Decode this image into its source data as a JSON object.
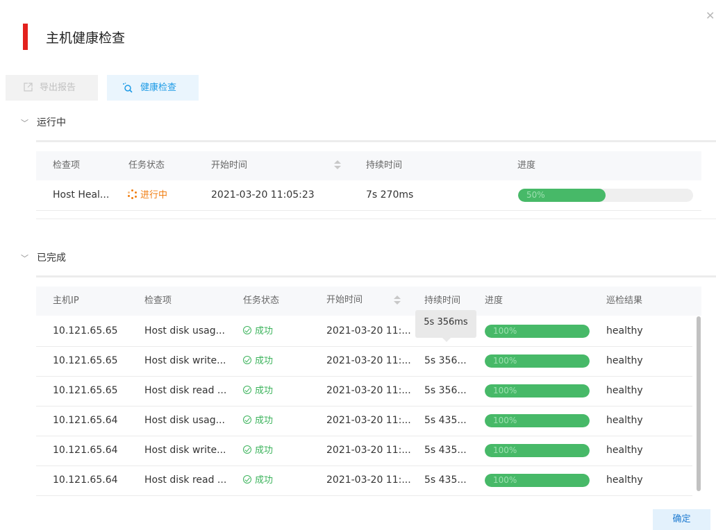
{
  "dialog": {
    "title": "主机健康检查",
    "accent_color": "#e3211d"
  },
  "toolbar": {
    "export_label": "导出报告",
    "check_label": "健康检查"
  },
  "running": {
    "section_label": "运行中",
    "columns": [
      "检查项",
      "任务状态",
      "开始时间",
      "持续时间",
      "进度"
    ],
    "rows": [
      {
        "item": "Host Heal...",
        "status": "进行中",
        "start": "2021-03-20 11:05:23",
        "duration": "7s 270ms",
        "progress": 0.5,
        "progress_label": "50%"
      }
    ]
  },
  "completed": {
    "section_label": "已完成",
    "columns": [
      "主机IP",
      "检查项",
      "任务状态",
      "开始时间",
      "持续时间",
      "进度",
      "巡检结果"
    ],
    "rows": [
      {
        "ip": "10.121.65.65",
        "item": "Host disk usag...",
        "status": "成功",
        "start": "2021-03-20 11:...",
        "duration": "5s 356...",
        "progress": 1.0,
        "progress_label": "100%",
        "result": "healthy"
      },
      {
        "ip": "10.121.65.65",
        "item": "Host disk write...",
        "status": "成功",
        "start": "2021-03-20 11:...",
        "duration": "5s 356...",
        "progress": 1.0,
        "progress_label": "100%",
        "result": "healthy"
      },
      {
        "ip": "10.121.65.65",
        "item": "Host disk read ...",
        "status": "成功",
        "start": "2021-03-20 11:...",
        "duration": "5s 356...",
        "progress": 1.0,
        "progress_label": "100%",
        "result": "healthy"
      },
      {
        "ip": "10.121.65.64",
        "item": "Host disk usag...",
        "status": "成功",
        "start": "2021-03-20 11:...",
        "duration": "5s 435...",
        "progress": 1.0,
        "progress_label": "100%",
        "result": "healthy"
      },
      {
        "ip": "10.121.65.64",
        "item": "Host disk write...",
        "status": "成功",
        "start": "2021-03-20 11:...",
        "duration": "5s 435...",
        "progress": 1.0,
        "progress_label": "100%",
        "result": "healthy"
      },
      {
        "ip": "10.121.65.64",
        "item": "Host disk read ...",
        "status": "成功",
        "start": "2021-03-20 11:...",
        "duration": "5s 435...",
        "progress": 1.0,
        "progress_label": "100%",
        "result": "healthy"
      }
    ],
    "tooltip": "5s 356ms"
  },
  "footer": {
    "confirm_label": "确定"
  },
  "colors": {
    "success": "#3bb35b",
    "running": "#f07d10",
    "progress_fill": "#47b968",
    "link_blue": "#1e9be6"
  },
  "icons": {
    "close": "close-icon",
    "export": "export-icon",
    "health_check": "search-spin-icon",
    "section_toggle": "chevron-down-icon",
    "sort": "sort-icon",
    "success": "check-circle-icon",
    "running": "loading-icon"
  }
}
